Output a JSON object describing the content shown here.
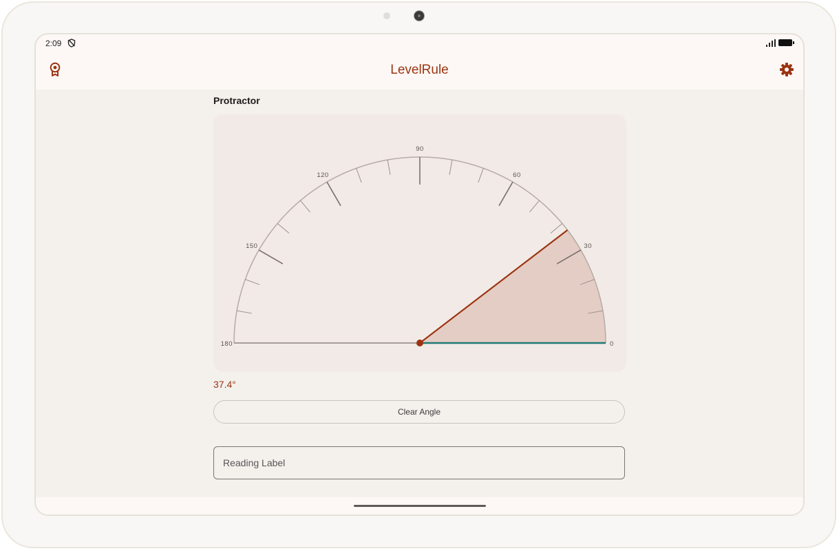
{
  "status_bar": {
    "time": "2:09",
    "icons": [
      "shield-icon",
      "signal-icon",
      "battery-icon"
    ]
  },
  "app_bar": {
    "title": "LevelRule",
    "left_icon": "award-icon",
    "right_icon": "gear-icon"
  },
  "protractor": {
    "section_title": "Protractor",
    "scale_labels": [
      "0",
      "30",
      "60",
      "90",
      "120",
      "150",
      "180"
    ],
    "angle_degrees": 37.4,
    "angle_text": "37.4°",
    "colors": {
      "card": "#f2eae6",
      "arc": "#b5aaa6",
      "ticks": "#6f6866",
      "measure_ray": "#9b3412",
      "baseline_ray": "#1f7a76",
      "wedge_fill": "#e4cdc4",
      "vertex": "#9b3412"
    }
  },
  "actions": {
    "clear_label": "Clear Angle"
  },
  "reading_label": {
    "placeholder": "Reading Label",
    "value": ""
  }
}
